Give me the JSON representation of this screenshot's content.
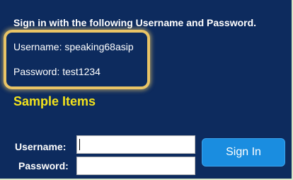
{
  "instructions": "Sign in with the following Username and Password.",
  "credentials": {
    "username_line": "Username: speaking68asip",
    "password_line": "Password: test1234"
  },
  "section_title": "Sample Items",
  "form": {
    "username_label": "Username:",
    "password_label": "Password:",
    "username_value": "",
    "password_value": "",
    "submit_label": "Sign In"
  },
  "colors": {
    "background": "#0d2b5e",
    "highlight_border": "#e9c466",
    "section_title": "#f2e21c",
    "button": "#1a8de0"
  }
}
